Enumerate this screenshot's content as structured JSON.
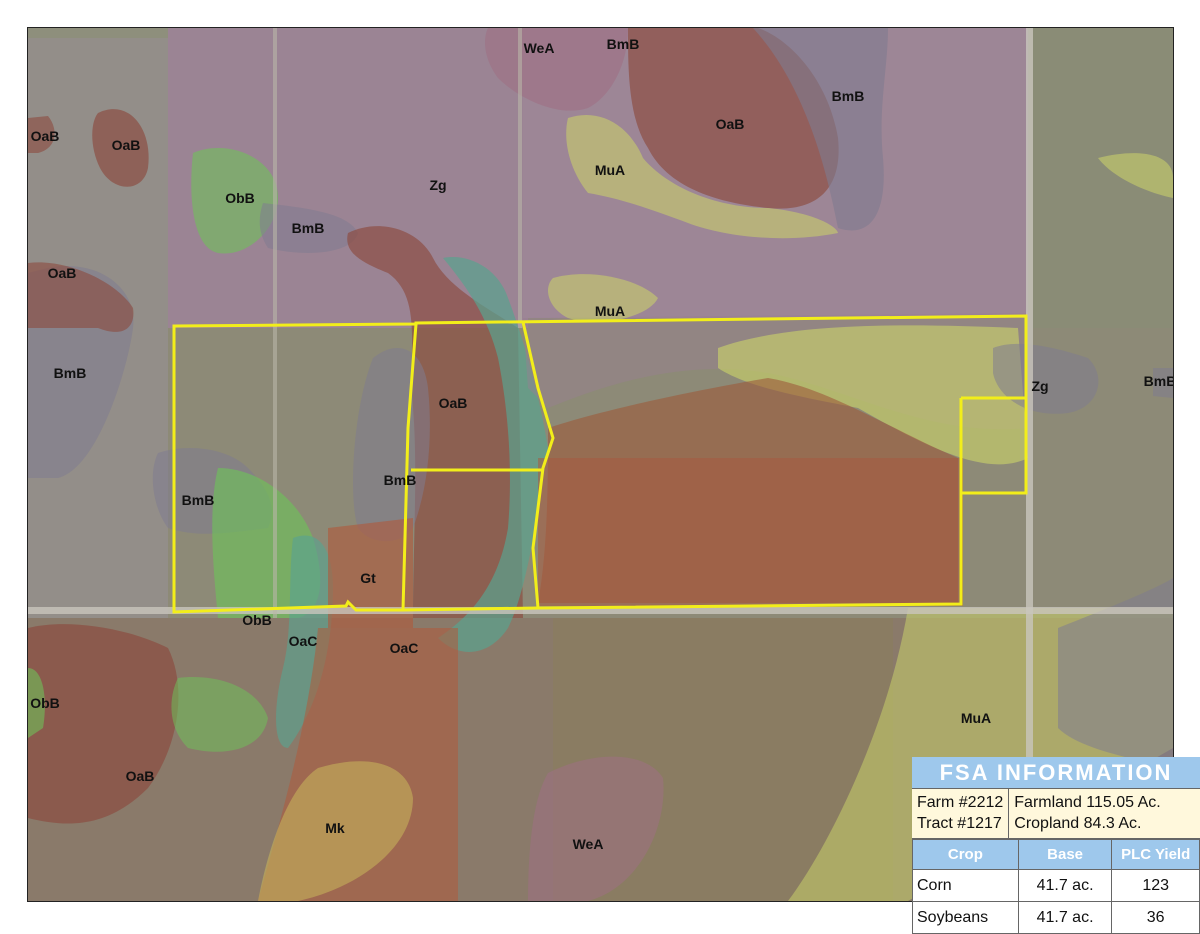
{
  "map": {
    "soil_labels": [
      {
        "text": "WeA"
      },
      {
        "text": "BmB"
      },
      {
        "text": "BmB"
      },
      {
        "text": "OaB"
      },
      {
        "text": "OaB"
      },
      {
        "text": "OaB"
      },
      {
        "text": "MuA"
      },
      {
        "text": "ObB"
      },
      {
        "text": "Zg"
      },
      {
        "text": "BmB"
      },
      {
        "text": "OaB"
      },
      {
        "text": "MuA"
      },
      {
        "text": "BmB"
      },
      {
        "text": "OaB"
      },
      {
        "text": "Zg"
      },
      {
        "text": "BmB"
      },
      {
        "text": "BmB"
      },
      {
        "text": "BmB"
      },
      {
        "text": "Gt"
      },
      {
        "text": "ObB"
      },
      {
        "text": "OaC"
      },
      {
        "text": "OaC"
      },
      {
        "text": "ObB"
      },
      {
        "text": "MuA"
      },
      {
        "text": "OaB"
      },
      {
        "text": "Mk"
      },
      {
        "text": "WeA"
      }
    ],
    "colors": {
      "boundary": "#f2ee1a",
      "zg": "#9a7f92",
      "oab": "#8c4a3e",
      "bmb": "#7f7c90",
      "mua": "#c8cf6a",
      "obb": "#6fc05a",
      "oac": "#5aa38f",
      "gt": "#b0593a",
      "wea": "#9e7084",
      "mk": "#c6b25a"
    }
  },
  "fsa": {
    "title": "FSA INFORMATION",
    "farm": "Farm #2212",
    "tract": "Tract #1217",
    "farmland": "Farmland 115.05 Ac.",
    "cropland": "Cropland 84.3 Ac.",
    "headers": {
      "crop": "Crop",
      "base": "Base",
      "yield": "PLC Yield"
    },
    "rows": [
      {
        "crop": "Corn",
        "base": "41.7 ac.",
        "yield": "123"
      },
      {
        "crop": "Soybeans",
        "base": "41.7 ac.",
        "yield": "36"
      }
    ]
  }
}
